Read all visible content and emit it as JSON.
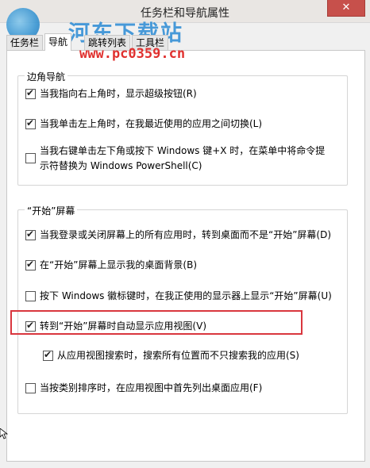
{
  "window": {
    "title": "任务栏和导航属性",
    "close_glyph": "✕"
  },
  "watermark": {
    "name": "河东下载站",
    "url": "www.pc0359.cn"
  },
  "tabs": [
    {
      "label": "任务栏"
    },
    {
      "label": "导航"
    },
    {
      "label": "跳转列表"
    },
    {
      "label": "工具栏"
    }
  ],
  "corner_nav": {
    "title": "边角导航",
    "options": [
      {
        "label": "当我指向右上角时，显示超级按钮(R)",
        "checked": true
      },
      {
        "label": "当我单击左上角时，在我最近使用的应用之间切换(L)",
        "checked": true
      },
      {
        "label": "当我右键单击左下角或按下 Windows 键+X 时，在菜单中将命令提示符替换为 Windows PowerShell(C)",
        "checked": false
      }
    ]
  },
  "start_screen": {
    "title": "“开始”屏幕",
    "options": [
      {
        "label": "当我登录或关闭屏幕上的所有应用时，转到桌面而不是“开始”屏幕(D)",
        "checked": true
      },
      {
        "label": "在“开始”屏幕上显示我的桌面背景(B)",
        "checked": true
      },
      {
        "label": "按下 Windows 徽标键时，在我正使用的显示器上显示“开始”屏幕(U)",
        "checked": false
      },
      {
        "label": "转到“开始”屏幕时自动显示应用视图(V)",
        "checked": true
      },
      {
        "label": "从应用视图搜索时，搜索所有位置而不只搜索我的应用(S)",
        "checked": true
      },
      {
        "label": "当按类别排序时，在应用视图中首先列出桌面应用(F)",
        "checked": false
      }
    ]
  },
  "colors": {
    "highlight": "#d9363e",
    "close_button": "#c7504b",
    "watermark_blue": "#2a8ad4",
    "watermark_red": "#e0312f"
  },
  "icons": {
    "checkmark": "✔",
    "cursor": "arrow-cursor-icon"
  }
}
